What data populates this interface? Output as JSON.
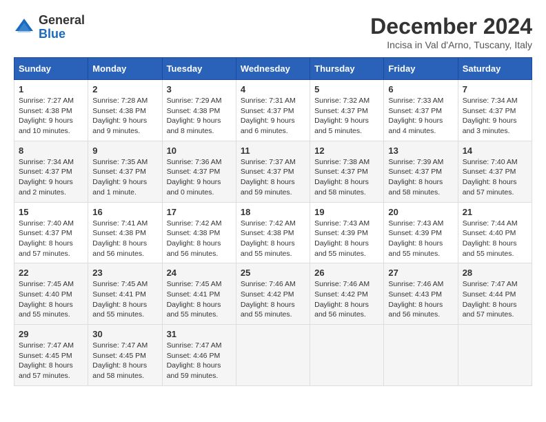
{
  "logo": {
    "general": "General",
    "blue": "Blue"
  },
  "title": "December 2024",
  "subtitle": "Incisa in Val d'Arno, Tuscany, Italy",
  "days_of_week": [
    "Sunday",
    "Monday",
    "Tuesday",
    "Wednesday",
    "Thursday",
    "Friday",
    "Saturday"
  ],
  "weeks": [
    [
      {
        "day": "1",
        "sunrise": "Sunrise: 7:27 AM",
        "sunset": "Sunset: 4:38 PM",
        "daylight": "Daylight: 9 hours and 10 minutes."
      },
      {
        "day": "2",
        "sunrise": "Sunrise: 7:28 AM",
        "sunset": "Sunset: 4:38 PM",
        "daylight": "Daylight: 9 hours and 9 minutes."
      },
      {
        "day": "3",
        "sunrise": "Sunrise: 7:29 AM",
        "sunset": "Sunset: 4:38 PM",
        "daylight": "Daylight: 9 hours and 8 minutes."
      },
      {
        "day": "4",
        "sunrise": "Sunrise: 7:31 AM",
        "sunset": "Sunset: 4:37 PM",
        "daylight": "Daylight: 9 hours and 6 minutes."
      },
      {
        "day": "5",
        "sunrise": "Sunrise: 7:32 AM",
        "sunset": "Sunset: 4:37 PM",
        "daylight": "Daylight: 9 hours and 5 minutes."
      },
      {
        "day": "6",
        "sunrise": "Sunrise: 7:33 AM",
        "sunset": "Sunset: 4:37 PM",
        "daylight": "Daylight: 9 hours and 4 minutes."
      },
      {
        "day": "7",
        "sunrise": "Sunrise: 7:34 AM",
        "sunset": "Sunset: 4:37 PM",
        "daylight": "Daylight: 9 hours and 3 minutes."
      }
    ],
    [
      {
        "day": "8",
        "sunrise": "Sunrise: 7:34 AM",
        "sunset": "Sunset: 4:37 PM",
        "daylight": "Daylight: 9 hours and 2 minutes."
      },
      {
        "day": "9",
        "sunrise": "Sunrise: 7:35 AM",
        "sunset": "Sunset: 4:37 PM",
        "daylight": "Daylight: 9 hours and 1 minute."
      },
      {
        "day": "10",
        "sunrise": "Sunrise: 7:36 AM",
        "sunset": "Sunset: 4:37 PM",
        "daylight": "Daylight: 9 hours and 0 minutes."
      },
      {
        "day": "11",
        "sunrise": "Sunrise: 7:37 AM",
        "sunset": "Sunset: 4:37 PM",
        "daylight": "Daylight: 8 hours and 59 minutes."
      },
      {
        "day": "12",
        "sunrise": "Sunrise: 7:38 AM",
        "sunset": "Sunset: 4:37 PM",
        "daylight": "Daylight: 8 hours and 58 minutes."
      },
      {
        "day": "13",
        "sunrise": "Sunrise: 7:39 AM",
        "sunset": "Sunset: 4:37 PM",
        "daylight": "Daylight: 8 hours and 58 minutes."
      },
      {
        "day": "14",
        "sunrise": "Sunrise: 7:40 AM",
        "sunset": "Sunset: 4:37 PM",
        "daylight": "Daylight: 8 hours and 57 minutes."
      }
    ],
    [
      {
        "day": "15",
        "sunrise": "Sunrise: 7:40 AM",
        "sunset": "Sunset: 4:37 PM",
        "daylight": "Daylight: 8 hours and 57 minutes."
      },
      {
        "day": "16",
        "sunrise": "Sunrise: 7:41 AM",
        "sunset": "Sunset: 4:38 PM",
        "daylight": "Daylight: 8 hours and 56 minutes."
      },
      {
        "day": "17",
        "sunrise": "Sunrise: 7:42 AM",
        "sunset": "Sunset: 4:38 PM",
        "daylight": "Daylight: 8 hours and 56 minutes."
      },
      {
        "day": "18",
        "sunrise": "Sunrise: 7:42 AM",
        "sunset": "Sunset: 4:38 PM",
        "daylight": "Daylight: 8 hours and 55 minutes."
      },
      {
        "day": "19",
        "sunrise": "Sunrise: 7:43 AM",
        "sunset": "Sunset: 4:39 PM",
        "daylight": "Daylight: 8 hours and 55 minutes."
      },
      {
        "day": "20",
        "sunrise": "Sunrise: 7:43 AM",
        "sunset": "Sunset: 4:39 PM",
        "daylight": "Daylight: 8 hours and 55 minutes."
      },
      {
        "day": "21",
        "sunrise": "Sunrise: 7:44 AM",
        "sunset": "Sunset: 4:40 PM",
        "daylight": "Daylight: 8 hours and 55 minutes."
      }
    ],
    [
      {
        "day": "22",
        "sunrise": "Sunrise: 7:45 AM",
        "sunset": "Sunset: 4:40 PM",
        "daylight": "Daylight: 8 hours and 55 minutes."
      },
      {
        "day": "23",
        "sunrise": "Sunrise: 7:45 AM",
        "sunset": "Sunset: 4:41 PM",
        "daylight": "Daylight: 8 hours and 55 minutes."
      },
      {
        "day": "24",
        "sunrise": "Sunrise: 7:45 AM",
        "sunset": "Sunset: 4:41 PM",
        "daylight": "Daylight: 8 hours and 55 minutes."
      },
      {
        "day": "25",
        "sunrise": "Sunrise: 7:46 AM",
        "sunset": "Sunset: 4:42 PM",
        "daylight": "Daylight: 8 hours and 55 minutes."
      },
      {
        "day": "26",
        "sunrise": "Sunrise: 7:46 AM",
        "sunset": "Sunset: 4:42 PM",
        "daylight": "Daylight: 8 hours and 56 minutes."
      },
      {
        "day": "27",
        "sunrise": "Sunrise: 7:46 AM",
        "sunset": "Sunset: 4:43 PM",
        "daylight": "Daylight: 8 hours and 56 minutes."
      },
      {
        "day": "28",
        "sunrise": "Sunrise: 7:47 AM",
        "sunset": "Sunset: 4:44 PM",
        "daylight": "Daylight: 8 hours and 57 minutes."
      }
    ],
    [
      {
        "day": "29",
        "sunrise": "Sunrise: 7:47 AM",
        "sunset": "Sunset: 4:45 PM",
        "daylight": "Daylight: 8 hours and 57 minutes."
      },
      {
        "day": "30",
        "sunrise": "Sunrise: 7:47 AM",
        "sunset": "Sunset: 4:45 PM",
        "daylight": "Daylight: 8 hours and 58 minutes."
      },
      {
        "day": "31",
        "sunrise": "Sunrise: 7:47 AM",
        "sunset": "Sunset: 4:46 PM",
        "daylight": "Daylight: 8 hours and 59 minutes."
      },
      null,
      null,
      null,
      null
    ]
  ]
}
